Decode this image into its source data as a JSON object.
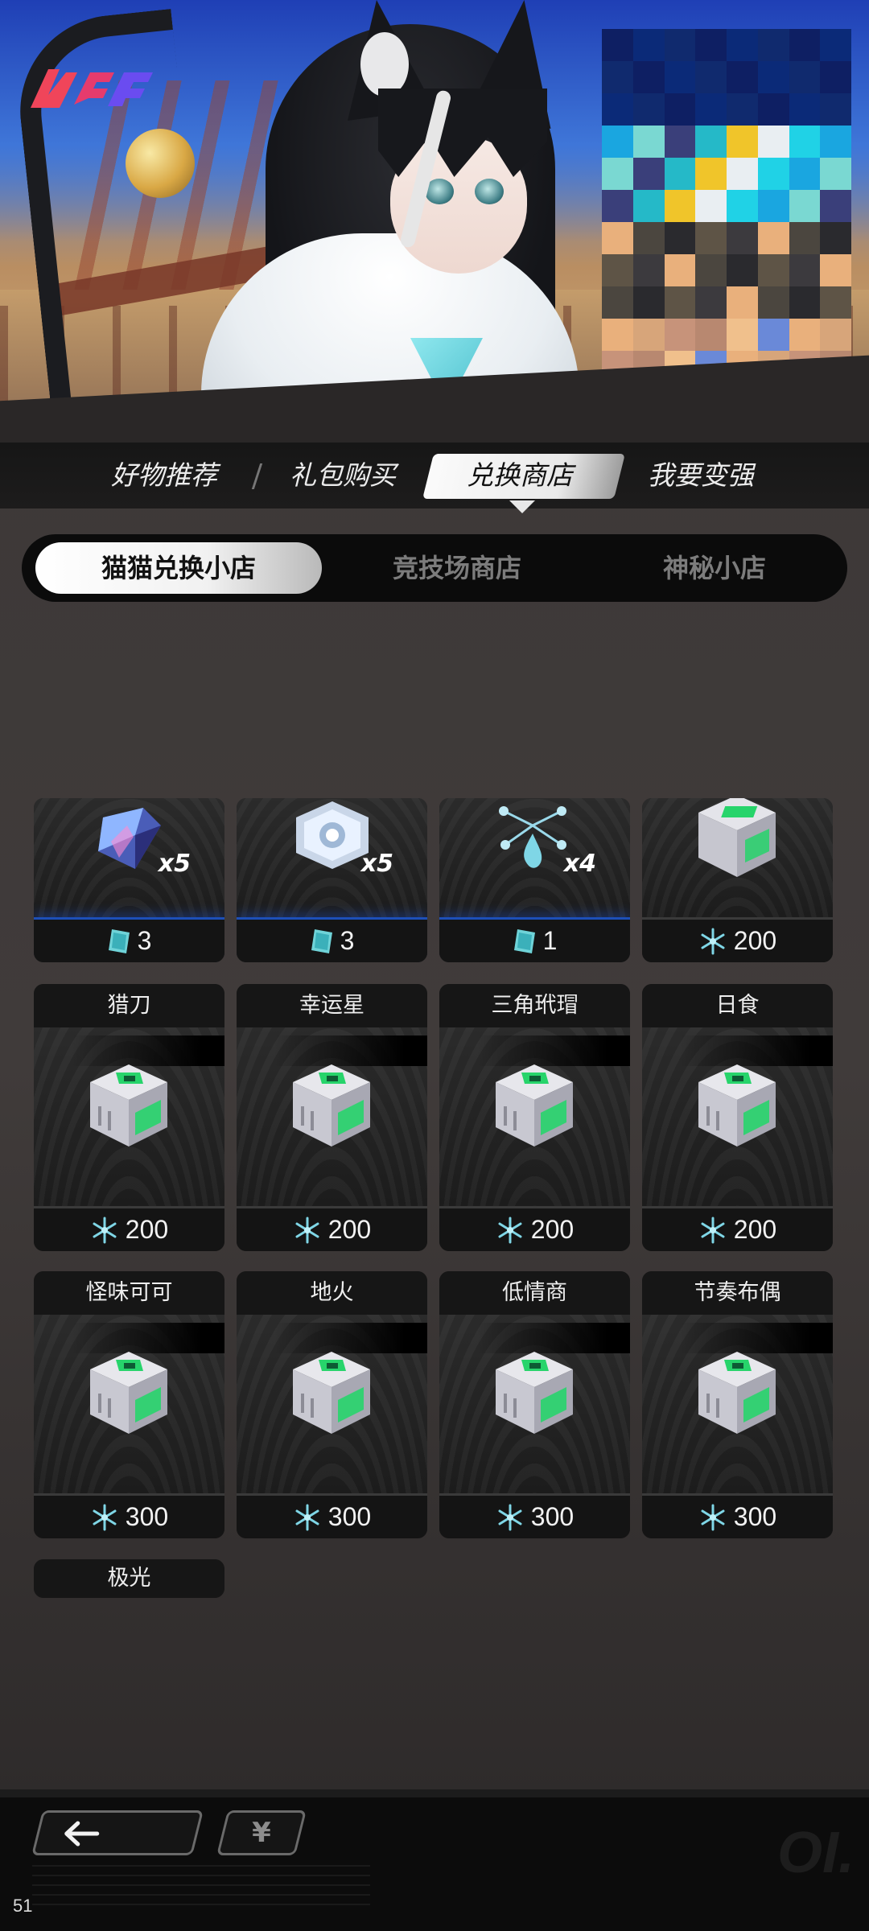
{
  "main_tabs": [
    "好物推荐",
    "礼包购买",
    "兑换商店",
    "我要变强"
  ],
  "active_main_tab": "兑换商店",
  "sub_tabs": [
    "猫猫兑换小店",
    "竞技场商店",
    "神秘小店"
  ],
  "active_sub_tab": "猫猫兑换小店",
  "top_row": [
    {
      "icon": "crystal-gem-icon",
      "qty": "x5",
      "price": "3",
      "currency": "ticket-icon"
    },
    {
      "icon": "hex-badge-icon",
      "qty": "x5",
      "price": "3",
      "currency": "ticket-icon"
    },
    {
      "icon": "water-drop-icon",
      "qty": "x4",
      "price": "1",
      "currency": "ticket-icon"
    },
    {
      "icon": "cube-box-icon",
      "qty": "",
      "price": "200",
      "currency": "snowflake-icon"
    }
  ],
  "items_row1": [
    {
      "name": "猎刀",
      "price": "200"
    },
    {
      "name": "幸运星",
      "price": "200"
    },
    {
      "name": "三角玳瑁",
      "price": "200"
    },
    {
      "name": "日食",
      "price": "200"
    }
  ],
  "items_row2": [
    {
      "name": "怪味可可",
      "price": "300"
    },
    {
      "name": "地火",
      "price": "300"
    },
    {
      "name": "低情商",
      "price": "300"
    },
    {
      "name": "节奏布偶",
      "price": "300"
    }
  ],
  "items_row3": [
    {
      "name": "极光"
    }
  ],
  "bottom": {
    "back_icon": "arrow-left-icon",
    "currency_button": "¥",
    "watermark": "OI.",
    "page_number": "51"
  },
  "colors": {
    "accent_blue": "#1d4fb8",
    "cube_green": "#27d46b",
    "snowflake": "#7fd6e6"
  }
}
